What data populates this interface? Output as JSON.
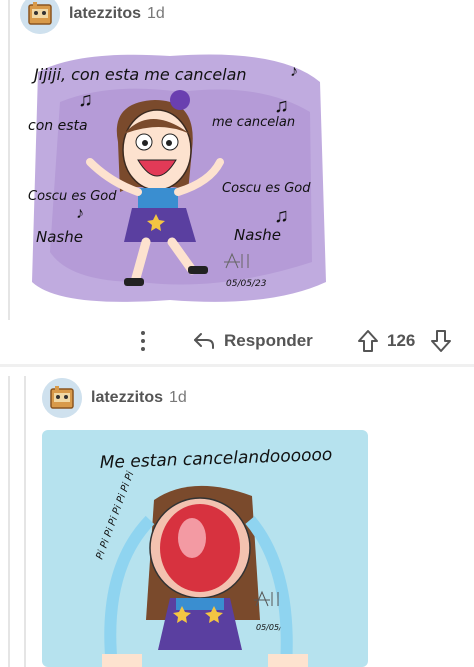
{
  "comments": [
    {
      "username": "latezzitos",
      "age": "1d",
      "avatar_icon": "cardboard-box-robot-avatar",
      "art": {
        "background": "#ffffff",
        "panel_color": "#b9a2dc",
        "lyrics_top": "Jijiji, con esta me cancelan",
        "left_1": "con esta",
        "right_1": "me cancelan",
        "left_2": "Coscu es God",
        "right_2": "Coscu es God",
        "left_3": "Nashe",
        "right_3": "Nashe",
        "date": "05/05/23"
      },
      "actions": {
        "more_icon": "vertical-ellipsis-icon",
        "reply_icon": "reply-arrow-icon",
        "reply_label": "Responder",
        "score": "126"
      }
    },
    {
      "username": "latezzitos",
      "age": "1d",
      "avatar_icon": "cardboard-box-robot-avatar",
      "art": {
        "background": "#b6e2ee",
        "caption": "Me estan cancelandoooooo",
        "pipi": "Pi Pi Pi Pi Pi Pi Pi Pi",
        "date": "05/05/23"
      }
    }
  ],
  "colors": {
    "text_primary": "#555555",
    "text_secondary": "#787878",
    "thread_line": "#e5e5e5",
    "art_purple": "#b9a2dc",
    "art_blue": "#b6e2ee"
  }
}
